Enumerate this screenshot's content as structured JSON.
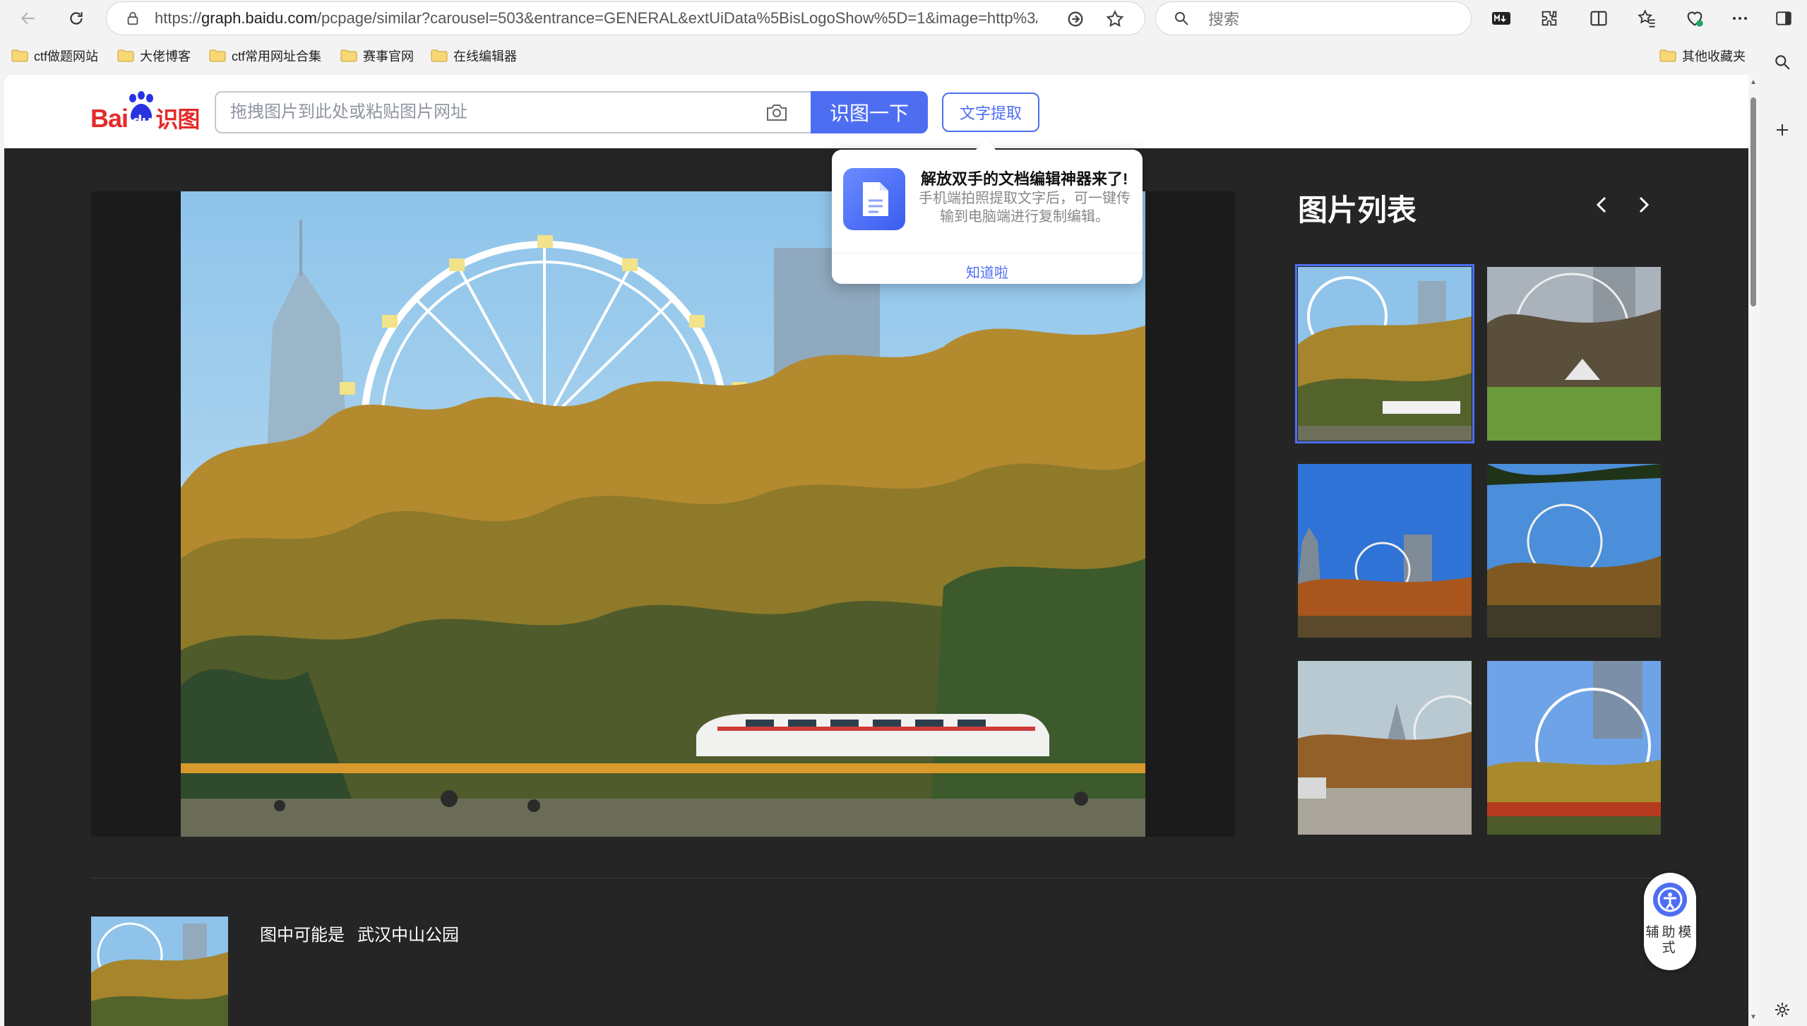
{
  "browser": {
    "url_prefix": "https://",
    "url_host": "graph.baidu.com",
    "url_path": "/pcpage/similar?carousel=503&entrance=GENERAL&extUiData%5BisLogoShow%5D=1&image=http%3A%2F...",
    "search_placeholder": "搜索"
  },
  "bookmarks": [
    {
      "label": "ctf做题网站"
    },
    {
      "label": "大佬博客"
    },
    {
      "label": "ctf常用网址合集"
    },
    {
      "label": "赛事官网"
    },
    {
      "label": "在线编辑器"
    }
  ],
  "other_bookmarks": "其他收藏夹",
  "header": {
    "logo_bai": "Bai",
    "logo_du": "du",
    "logo_shitu": "识图",
    "input_placeholder": "拖拽图片到此处或粘贴图片网址",
    "search_button": "识图一下",
    "extract_button": "文字提取"
  },
  "popover": {
    "title": "解放双手的文档编辑神器来了!",
    "desc": "手机端拍照提取文字后，可一键传输到电脑端进行复制编辑。",
    "ok": "知道啦"
  },
  "image_list": {
    "title": "图片列表",
    "thumbnails": [
      {
        "selected": true
      },
      {
        "selected": false
      },
      {
        "selected": false
      },
      {
        "selected": false
      },
      {
        "selected": false
      },
      {
        "selected": false
      }
    ]
  },
  "result": {
    "prefix": "图中可能是",
    "name": "武汉中山公园"
  },
  "assist": {
    "label": "辅助模式"
  }
}
